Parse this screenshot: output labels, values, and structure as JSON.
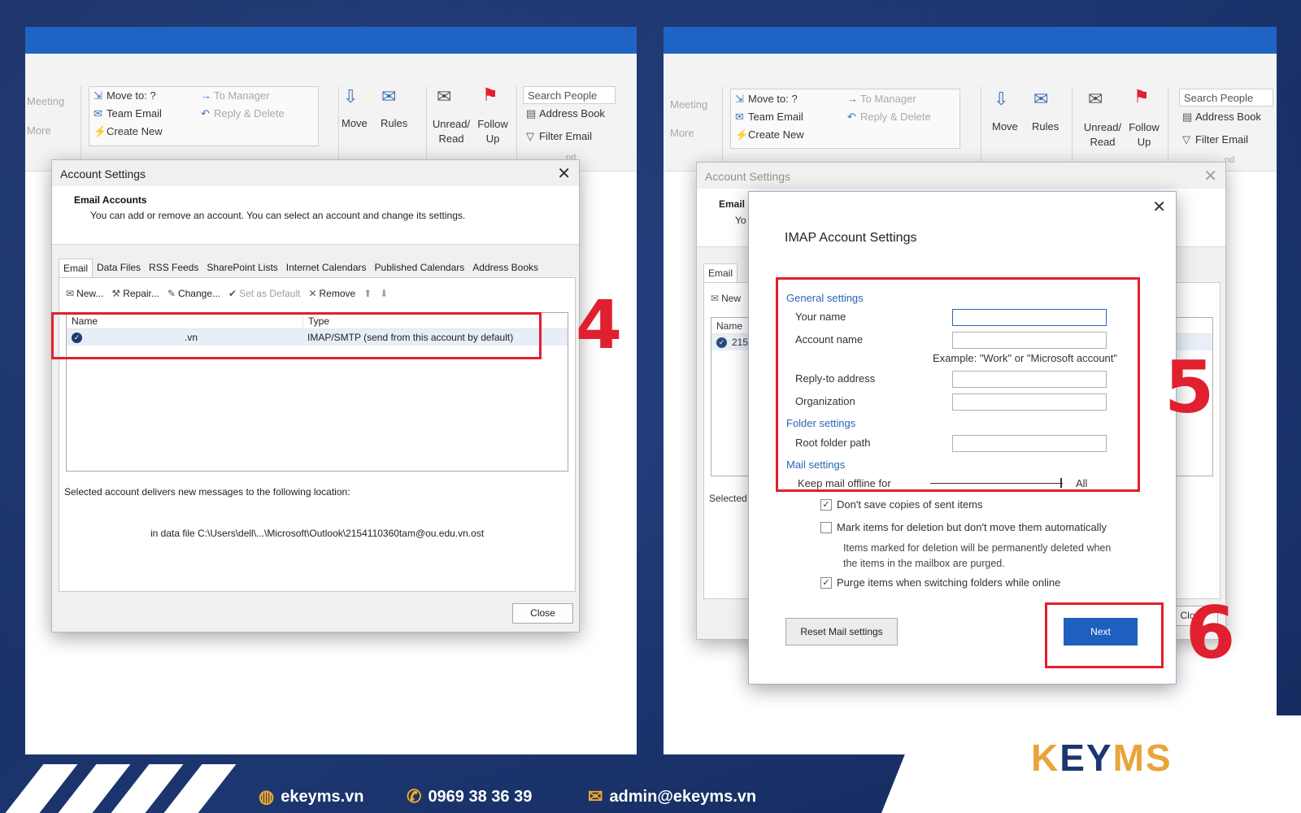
{
  "ribbon": {
    "meeting": "Meeting",
    "more": "More",
    "quick_steps": [
      "Move to: ?",
      "Team Email",
      "Create New"
    ],
    "quick_steps_dim": [
      "To Manager",
      "Reply & Delete"
    ],
    "move": "Move",
    "rules": "Rules",
    "unread_read": "Unread/ Read",
    "follow_up": "Follow Up",
    "search_people": "Search People",
    "address_book": "Address Book",
    "filter_email": "Filter Email",
    "nd": "nd"
  },
  "account_settings": {
    "title": "Account Settings",
    "header_title": "Email Accounts",
    "header_desc": "You can add or remove an account. You can select an account and change its settings.",
    "tabs": [
      "Email",
      "Data Files",
      "RSS Feeds",
      "SharePoint Lists",
      "Internet Calendars",
      "Published Calendars",
      "Address Books"
    ],
    "toolbar": {
      "new": "New...",
      "repair": "Repair...",
      "change": "Change...",
      "set_default": "Set as Default",
      "remove": "Remove"
    },
    "columns": [
      "Name",
      "Type"
    ],
    "row": {
      "name_suffix": ".vn",
      "type": "IMAP/SMTP (send from this account by default)"
    },
    "deliver_text": "Selected account delivers new messages to the following location:",
    "data_file_text": "in data file C:\\Users\\dell\\...\\Microsoft\\Outlook\\2154110360tam@ou.edu.vn.ost",
    "close": "Close"
  },
  "right_bg_dialog": {
    "title": "Account Settings",
    "email_bold": "Email",
    "yo": "Yo",
    "email_tab": "Email",
    "new": "New",
    "name_col": "Name",
    "row_prefix": "2154",
    "selected": "Selected",
    "clo": "Clo"
  },
  "imap": {
    "title": "IMAP Account Settings",
    "general": "General settings",
    "your_name": "Your name",
    "account_name": "Account name",
    "example": "Example: \"Work\" or \"Microsoft account\"",
    "reply_to": "Reply-to address",
    "organization": "Organization",
    "folder": "Folder settings",
    "root_folder": "Root folder path",
    "mail": "Mail settings",
    "keep_offline": "Keep mail offline for",
    "keep_value": "All",
    "cb1": "Don't save copies of sent items",
    "cb2": "Mark items for deletion but don't move them automatically",
    "note": "Items marked for deletion will be permanently deleted when the items in the mailbox are purged.",
    "cb3": "Purge items when switching folders while online",
    "reset": "Reset Mail settings",
    "next": "Next"
  },
  "step_numbers": {
    "four": "4",
    "five": "5",
    "six": "6"
  },
  "footer": {
    "website": "ekeyms.vn",
    "phone": "0969 38 36 39",
    "email": "admin@ekeyms.vn",
    "logo": "KEYMS"
  },
  "colors": {
    "accent_red": "#e0202e",
    "brand_blue": "#1f5fbf",
    "brand_orange": "#e9a43a"
  }
}
